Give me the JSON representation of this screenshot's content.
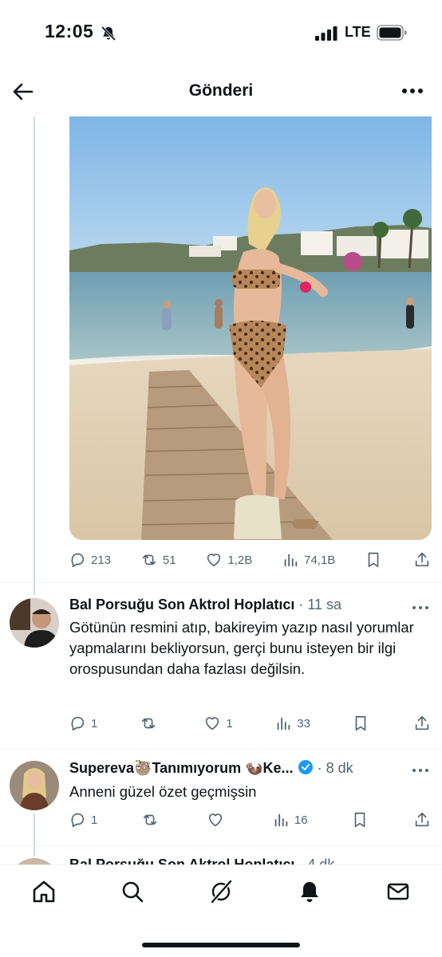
{
  "status": {
    "time": "12:05",
    "network": "LTE",
    "icons": [
      "bell-slash-icon",
      "signal-icon",
      "battery-icon"
    ]
  },
  "header": {
    "title": "Gönderi",
    "back_icon": "arrow-left-icon",
    "more_icon": "more-horizontal-icon"
  },
  "post": {
    "image_description_icon": "photo",
    "stats": {
      "replies": "213",
      "reposts": "51",
      "likes": "1,2B",
      "views": "74,1B"
    }
  },
  "replies": [
    {
      "author": "Bal Porsuğu Son Aktrol Hoplatıcı",
      "time": "· 11 sa",
      "text": "Götünün resmini atıp, bakireyim yazıp nasıl yorumlar yapmalarını bekliyorsun,  gerçi bunu isteyen bir ilgi orospusundan daha fazlası değilsin.",
      "stats": {
        "replies": "1",
        "reposts": "",
        "likes": "1",
        "views": "33"
      }
    },
    {
      "author": "Supereva🦥Tanımıyorum 🦦Ke...",
      "time": "· 8 dk",
      "verified": true,
      "text": "Anneni güzel özet geçmişsin",
      "stats": {
        "replies": "1",
        "reposts": "",
        "likes": "",
        "views": "16"
      }
    }
  ],
  "peek": {
    "author": "Bal Porsuğu Son Aktrol Hoplatıcı",
    "time": "· 4 dk"
  },
  "tabs": [
    "home-icon",
    "search-icon",
    "grok-icon",
    "notifications-icon",
    "messages-icon"
  ],
  "colors": {
    "text": "#0f1419",
    "muted": "#536471",
    "verified": "#1d9bf0",
    "line": "#cfd9de"
  }
}
